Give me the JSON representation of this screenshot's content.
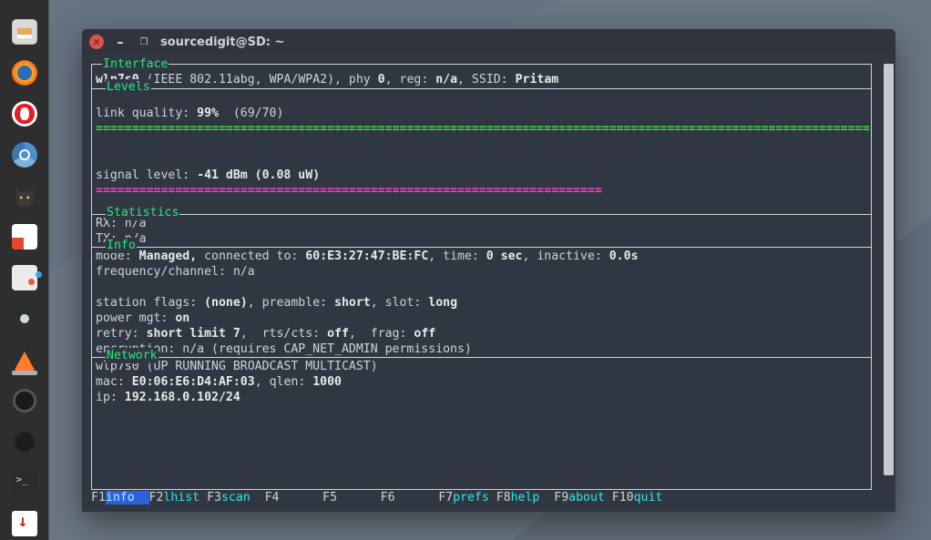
{
  "window": {
    "title": "sourcedigit@SD: ~"
  },
  "sections": {
    "interface": {
      "label": "Interface",
      "line": {
        "ifname": "wlp7s0",
        "std": "(IEEE 802.11abg, WPA/WPA2), phy ",
        "phy": "0",
        "reg_lbl": ", reg: ",
        "reg": "n/a",
        "ssid_lbl": ", SSID: ",
        "ssid": "Pritam"
      }
    },
    "levels": {
      "label": "Levels",
      "link_quality": {
        "label": "link quality: ",
        "pct": "99%",
        "ratio": "  (69/70)"
      },
      "link_bar_len": 107,
      "signal": {
        "label": "signal level: ",
        "val": "-41 dBm (0.08 uW)"
      },
      "signal_bar_len": 70
    },
    "statistics": {
      "label": "Statistics",
      "rx": "RX: n/a",
      "tx": "TX: n/a"
    },
    "info": {
      "label": "Info",
      "mode_lbl": "mode: ",
      "mode": "Managed,",
      "conn_lbl": " connected to: ",
      "conn": "60:E3:27:47:BE:FC",
      "time_lbl": ", time: ",
      "time": "0 sec",
      "inact_lbl": ", inactive: ",
      "inact": "0.0s",
      "freq": "frequency/channel: n/a",
      "flags_lbl": "station flags: ",
      "flags": "(none)",
      "preamble_lbl": ", preamble: ",
      "preamble": "short",
      "slot_lbl": ", slot: ",
      "slot": "long",
      "pm_lbl": "power mgt: ",
      "pm": "on",
      "retry_lbl": "retry: ",
      "retry": "short limit 7",
      "rts_lbl": ",  rts/cts: ",
      "rts": "off",
      "frag_lbl": ",  frag: ",
      "frag": "off",
      "enc": "encryption: n/a (requires CAP_NET_ADMIN permissions)"
    },
    "network": {
      "label": "Network",
      "ifline": "wlp7s0 (UP RUNNING BROADCAST MULTICAST)",
      "mac_lbl": "mac: ",
      "mac": "E0:06:E6:D4:AF:03",
      "qlen_lbl": ", qlen: ",
      "qlen": "1000",
      "ip_lbl": "ip: ",
      "ip": "192.168.0.102/24"
    }
  },
  "fkeys": [
    {
      "n": "F1",
      "t": "info",
      "hi": true
    },
    {
      "n": "F2",
      "t": "lhist"
    },
    {
      "n": "F3",
      "t": "scan"
    },
    {
      "n": "F4",
      "t": ""
    },
    {
      "n": "F5",
      "t": ""
    },
    {
      "n": "F6",
      "t": ""
    },
    {
      "n": "F7",
      "t": "prefs"
    },
    {
      "n": "F8",
      "t": "help"
    },
    {
      "n": "F9",
      "t": "about"
    },
    {
      "n": "F10",
      "t": "quit"
    }
  ],
  "dock": {
    "items": [
      "files",
      "firefox",
      "opera",
      "chromium",
      "cat",
      "note",
      "tweaks",
      "dot",
      "vlc",
      "lens",
      "lens2",
      "term",
      "trans"
    ]
  }
}
